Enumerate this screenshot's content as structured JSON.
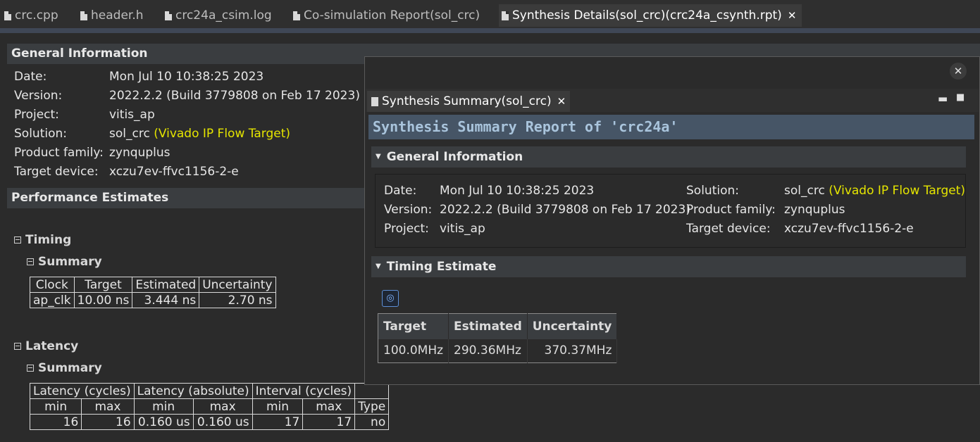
{
  "tabs": [
    {
      "label": "crc.cpp",
      "active": false
    },
    {
      "label": "header.h",
      "active": false
    },
    {
      "label": "crc24a_csim.log",
      "active": false
    },
    {
      "label": "Co-simulation Report(sol_crc)",
      "active": false
    },
    {
      "label": "Synthesis Details(sol_crc)(crc24a_csynth.rpt)",
      "active": true
    }
  ],
  "general": {
    "header": "General Information",
    "rows": [
      {
        "key": "Date:",
        "value": "Mon Jul 10 10:38:25 2023",
        "extra": ""
      },
      {
        "key": "Version:",
        "value": "2022.2.2 (Build 3779808 on Feb 17 2023)",
        "extra": ""
      },
      {
        "key": "Project:",
        "value": "vitis_ap",
        "extra": ""
      },
      {
        "key": "Solution:",
        "value": "sol_crc",
        "extra": "(Vivado IP Flow Target)"
      },
      {
        "key": "Product family:",
        "value": "zynquplus",
        "extra": ""
      },
      {
        "key": "Target device:",
        "value": "xczu7ev-ffvc1156-2-e",
        "extra": ""
      }
    ]
  },
  "performance": {
    "header": "Performance Estimates",
    "timing_label": "Timing",
    "timing_summary_label": "Summary",
    "timing_table": {
      "headers": [
        "Clock",
        "Target",
        "Estimated",
        "Uncertainty"
      ],
      "row": [
        "ap_clk",
        "10.00 ns",
        "3.444 ns",
        "2.70 ns"
      ]
    },
    "latency_label": "Latency",
    "latency_summary_label": "Summary",
    "latency_table": {
      "groups": [
        "Latency (cycles)",
        "Latency (absolute)",
        "Interval (cycles)",
        ""
      ],
      "sub": [
        "min",
        "max",
        "min",
        "max",
        "min",
        "max",
        "Type"
      ],
      "row": [
        "16",
        "16",
        "0.160 us",
        "0.160 us",
        "17",
        "17",
        "no"
      ]
    }
  },
  "popup": {
    "tab_label": "Synthesis Summary(sol_crc)",
    "title": "Synthesis Summary Report of 'crc24a'",
    "general_header": "General Information",
    "info_left": [
      {
        "key": "Date:",
        "value": "Mon Jul 10 10:38:25 2023"
      },
      {
        "key": "Version:",
        "value": "2022.2.2 (Build 3779808 on Feb 17 2023)"
      },
      {
        "key": "Project:",
        "value": "vitis_ap"
      }
    ],
    "info_right": [
      {
        "key": "Solution:",
        "value": "sol_crc",
        "extra": "(Vivado IP Flow Target)"
      },
      {
        "key": "Product family:",
        "value": "zynquplus",
        "extra": ""
      },
      {
        "key": "Target device:",
        "value": "xczu7ev-ffvc1156-2-e",
        "extra": ""
      }
    ],
    "timing_header": "Timing Estimate",
    "timing_table": {
      "headers": [
        "Target",
        "Estimated",
        "Uncertainty"
      ],
      "row": [
        "100.0MHz",
        "290.36MHz",
        "370.37MHz"
      ]
    }
  },
  "colors": {
    "highlight": "#e5e500",
    "title_bg": "#465566",
    "title_fg": "#a9c4dc"
  }
}
